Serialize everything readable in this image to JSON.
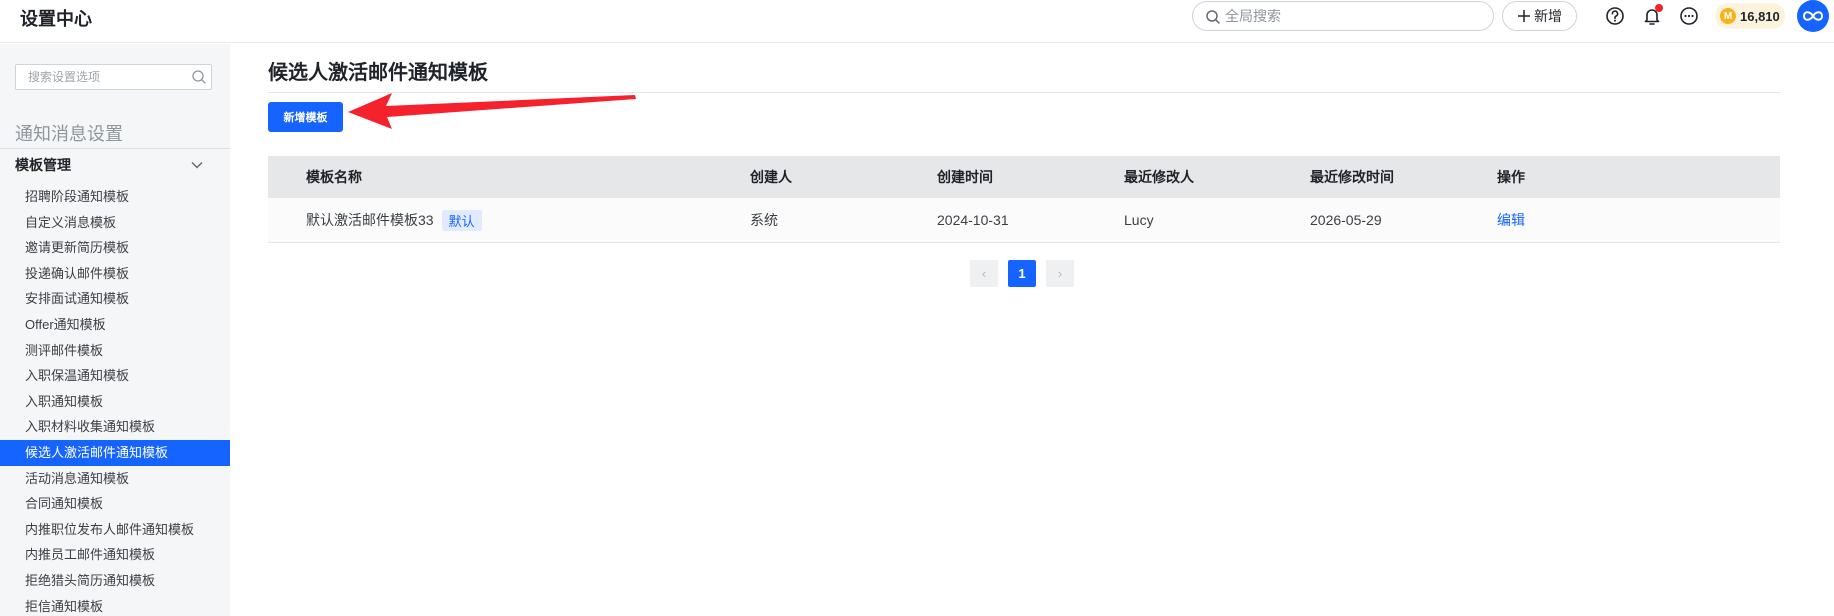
{
  "header": {
    "app_title": "设置中心",
    "search_placeholder": "全局搜索",
    "new_label": "新增",
    "points": "16,810",
    "coin_glyph": "M"
  },
  "sidebar": {
    "search_placeholder": "搜索设置选项",
    "section_title": "通知消息设置",
    "group_label": "模板管理",
    "items": [
      {
        "label": "招聘阶段通知模板",
        "active": false
      },
      {
        "label": "自定义消息模板",
        "active": false
      },
      {
        "label": "邀请更新简历模板",
        "active": false
      },
      {
        "label": "投递确认邮件模板",
        "active": false
      },
      {
        "label": "安排面试通知模板",
        "active": false
      },
      {
        "label": "Offer通知模板",
        "active": false
      },
      {
        "label": "测评邮件模板",
        "active": false
      },
      {
        "label": "入职保温通知模板",
        "active": false
      },
      {
        "label": "入职通知模板",
        "active": false
      },
      {
        "label": "入职材料收集通知模板",
        "active": false
      },
      {
        "label": "候选人激活邮件通知模板",
        "active": true
      },
      {
        "label": "活动消息通知模板",
        "active": false
      },
      {
        "label": "合同通知模板",
        "active": false
      },
      {
        "label": "内推职位发布人邮件通知模板",
        "active": false
      },
      {
        "label": "内推员工邮件通知模板",
        "active": false
      },
      {
        "label": "拒绝猎头简历通知模板",
        "active": false
      },
      {
        "label": "拒信通知模板",
        "active": false
      }
    ]
  },
  "main": {
    "title": "候选人激活邮件通知模板",
    "add_button": "新增模板",
    "table": {
      "columns": [
        "模板名称",
        "创建人",
        "创建时间",
        "最近修改人",
        "最近修改时间",
        "操作"
      ],
      "rows": [
        {
          "name": "默认激活邮件模板33",
          "tag": "默认",
          "creator": "系统",
          "created": "2024-10-31",
          "modifier": "Lucy",
          "modified": "2026-05-29",
          "action": "编辑"
        }
      ]
    },
    "pagination": {
      "prev": "‹",
      "current": "1",
      "next": "›"
    }
  },
  "colors": {
    "accent": "#1664ff",
    "annotation_arrow": "#f5222d"
  }
}
